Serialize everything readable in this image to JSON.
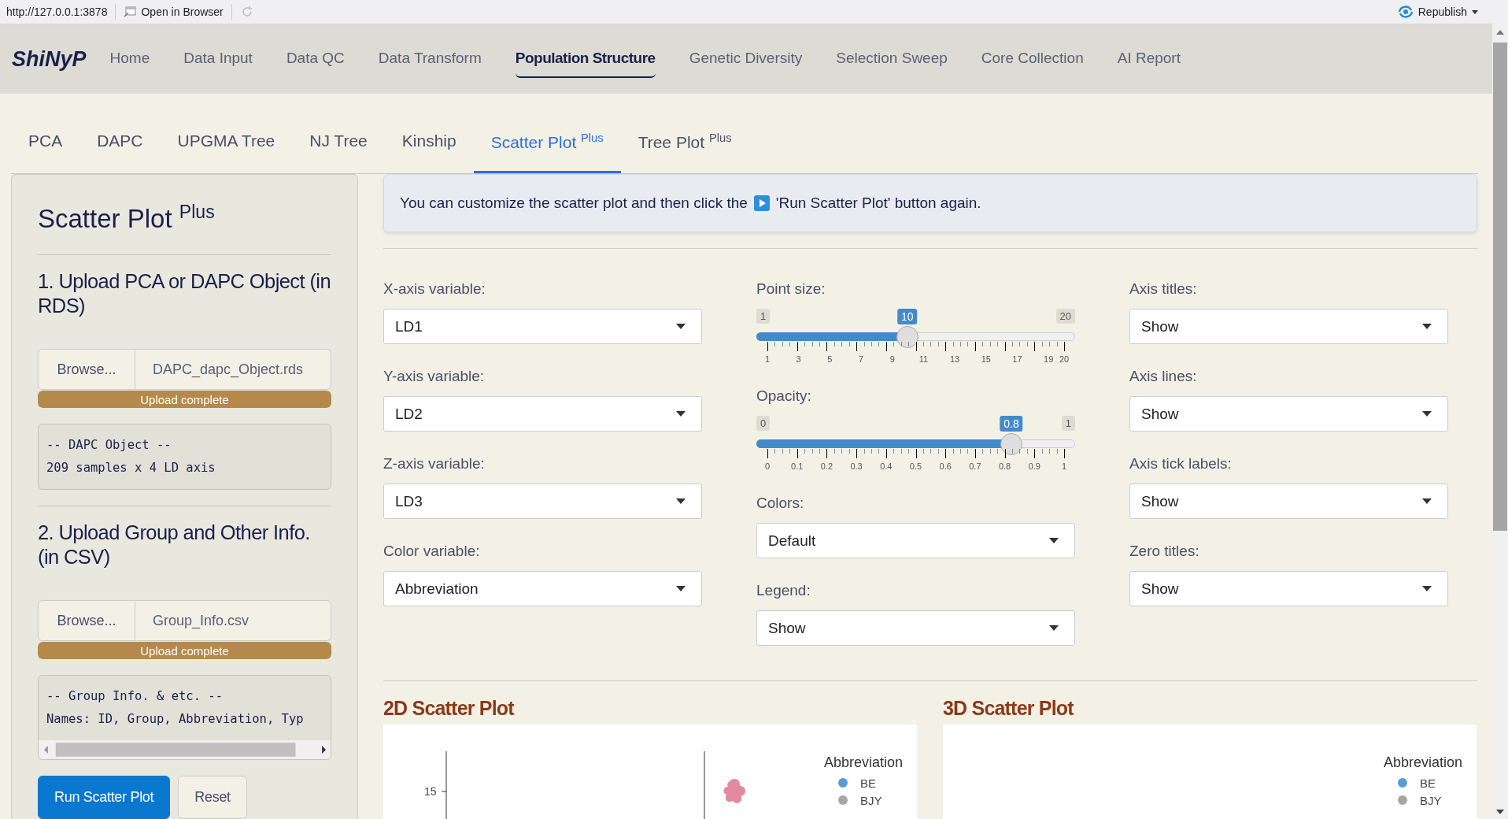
{
  "browser_bar": {
    "url": "http://127.0.0.1:3878",
    "open_button": "Open in Browser",
    "publish_button": "Republish"
  },
  "navbar": {
    "brand": "ShiNyP",
    "items": [
      {
        "label": "Home",
        "selected": false
      },
      {
        "label": "Data Input",
        "selected": false
      },
      {
        "label": "Data QC",
        "selected": false
      },
      {
        "label": "Data Transform",
        "selected": false
      },
      {
        "label": "Population Structure",
        "selected": true
      },
      {
        "label": "Genetic Diversity",
        "selected": false
      },
      {
        "label": "Selection Sweep",
        "selected": false
      },
      {
        "label": "Core Collection",
        "selected": false
      },
      {
        "label": "AI Report",
        "selected": false
      }
    ]
  },
  "tabs": [
    {
      "label": "PCA",
      "selected": false
    },
    {
      "label": "DAPC",
      "selected": false
    },
    {
      "label": "UPGMA Tree",
      "selected": false
    },
    {
      "label": "NJ Tree",
      "selected": false
    },
    {
      "label": "Kinship",
      "selected": false
    },
    {
      "label": "Scatter Plot $^{Plus}$",
      "selected": true
    },
    {
      "label": "Tree Plot $^{Plus}$",
      "selected": false
    }
  ],
  "sidebar": {
    "title": "Scatter Plot $^{Plus}$",
    "sections": [
      {
        "heading": "1. Upload PCA or DAPC Object (in RDS)",
        "browse": "Browse...",
        "file": "DAPC_dapc_Object.rds",
        "progress": "Upload complete",
        "level": 1,
        "output": [
          "-- DAPC Object --",
          "209 samples x 4 LD axis"
        ],
        "scroll": false
      },
      {
        "heading": "2. Upload Group and Other Info. (in CSV)",
        "browse": "Browse...",
        "file": "Group_Info.csv",
        "progress": "Upload complete",
        "level": 1,
        "output": [
          "-- Group Info. & etc. --",
          "Names: ID, Group, Abbreviation, Typ"
        ],
        "scroll": true
      }
    ],
    "buttons": [
      {
        "label": "Run Scatter Plot",
        "kind": "primary"
      },
      {
        "label": "Reset",
        "kind": "default"
      }
    ]
  },
  "info": {
    "before": "You can customize the scatter plot and then click the",
    "after": "'Run Scatter Plot' button again."
  },
  "columns": [
    [
      {
        "kind": "select",
        "label": "X-axis variable:",
        "value": "LD1"
      },
      {
        "kind": "select",
        "label": "Y-axis variable:",
        "value": "LD2"
      },
      {
        "kind": "select",
        "label": "Z-axis variable:",
        "value": "LD3"
      },
      {
        "kind": "select",
        "label": "Color variable:",
        "value": "Abbreviation"
      }
    ],
    [
      {
        "kind": "slider",
        "label": "Point size:",
        "min": "1",
        "max": "20",
        "value": "10",
        "level": 0.4737,
        "ticks": [
          "1",
          "3",
          "5",
          "7",
          "9",
          "11",
          "13",
          "15",
          "17",
          "19",
          "20"
        ]
      },
      {
        "kind": "slider",
        "label": "Opacity:",
        "min": "0",
        "max": "1",
        "value": "0.8",
        "level": 0.8,
        "ticks": [
          "0",
          "0.1",
          "0.2",
          "0.3",
          "0.4",
          "0.5",
          "0.6",
          "0.7",
          "0.8",
          "0.9",
          "1"
        ]
      },
      {
        "kind": "select",
        "label": "Colors:",
        "value": "Default"
      },
      {
        "kind": "select",
        "label": "Legend:",
        "value": "Show"
      }
    ],
    [
      {
        "kind": "select",
        "label": "Axis titles:",
        "value": "Show"
      },
      {
        "kind": "select",
        "label": "Axis lines:",
        "value": "Show"
      },
      {
        "kind": "select",
        "label": "Axis tick labels:",
        "value": "Show"
      },
      {
        "kind": "select",
        "label": "Zero titles:",
        "value": "Show"
      }
    ]
  ],
  "plots": [
    {
      "title": "2D Scatter Plot",
      "kind": "planar",
      "ytick": "15",
      "legend_title": "Abbreviation",
      "legend": [
        {
          "label": "BE",
          "color": "#5b9bd5"
        },
        {
          "label": "BJY",
          "color": "#a6a6a6"
        }
      ]
    },
    {
      "title": "3D Scatter Plot",
      "kind": "spatial",
      "legend_title": "Abbreviation",
      "legend": [
        {
          "label": "BE",
          "color": "#5b9bd5"
        },
        {
          "label": "BJY",
          "color": "#a6a6a6"
        }
      ]
    }
  ]
}
